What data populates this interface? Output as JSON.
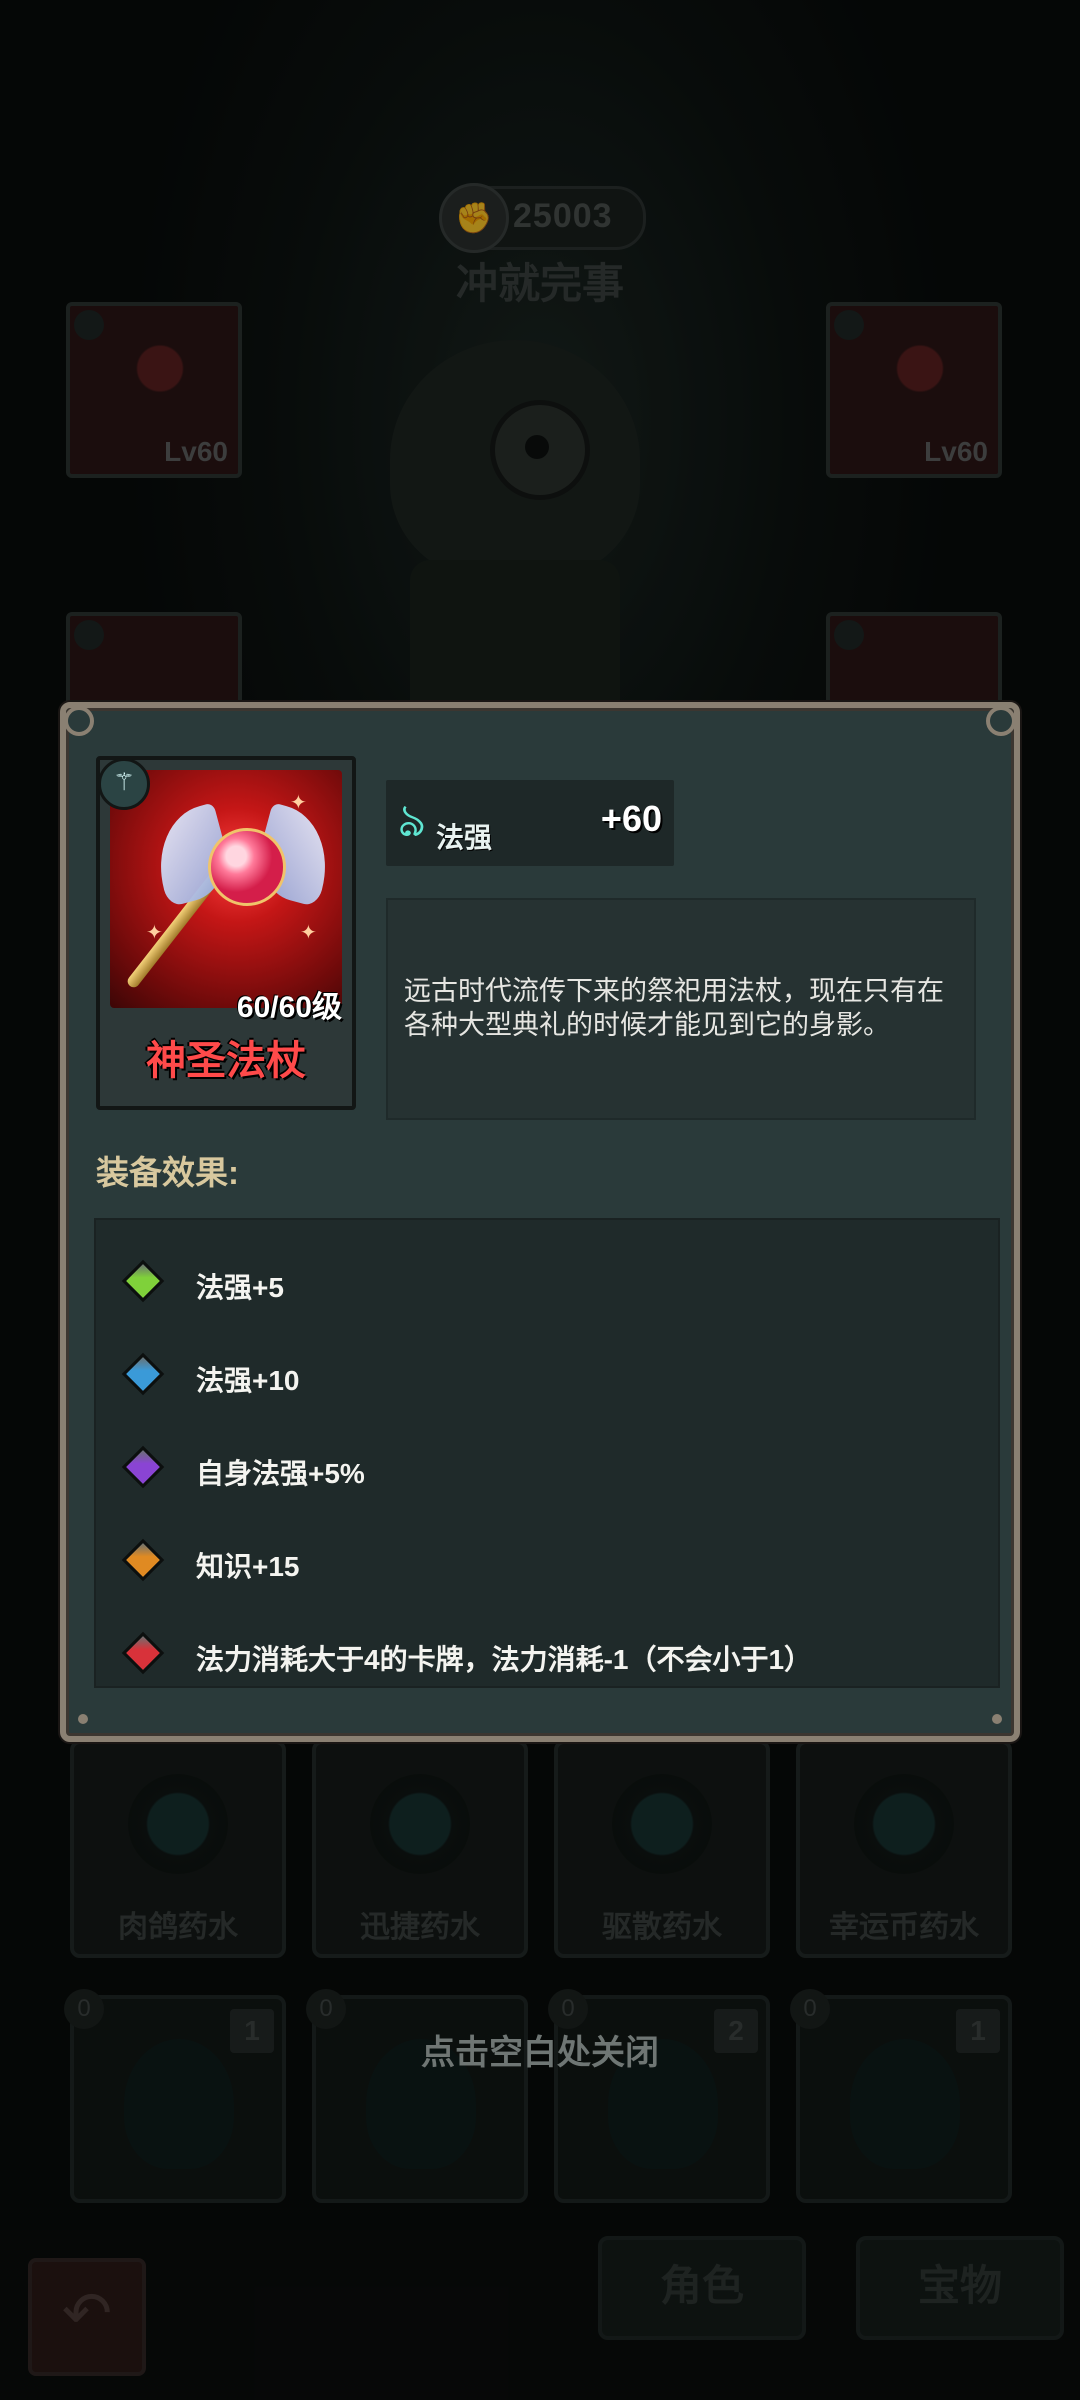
{
  "background": {
    "score": "25003",
    "character_name": "冲就完事",
    "equip_levels": [
      "Lv60",
      "Lv60"
    ],
    "potions": [
      "肉鸽药水",
      "迅捷药水",
      "驱散药水",
      "幸运币药水"
    ],
    "bottle_counts": [
      "1",
      "",
      "2",
      "1"
    ],
    "bottle_zero": "0",
    "tabs": [
      "角色",
      "宝物"
    ]
  },
  "modal": {
    "item": {
      "name": "神圣法杖",
      "level": "60/60级",
      "type_icon": "staff-icon"
    },
    "stat": {
      "label": "法强",
      "value": "+60",
      "icon": "flame-icon"
    },
    "description": "远古时代流传下来的祭祀用法杖，现在只有在各种大型典礼的时候才能见到它的身影。",
    "effects_title": "装备效果:",
    "effects": [
      {
        "text": "法强+5",
        "gem_color": "#7fd13a"
      },
      {
        "text": "法强+10",
        "gem_color": "#3a9ad8"
      },
      {
        "text": "自身法强+5%",
        "gem_color": "#8a44d4"
      },
      {
        "text": "知识+15",
        "gem_color": "#e08a22"
      },
      {
        "text": "法力消耗大于4的卡牌，法力消耗-1（不会小于1）",
        "gem_color": "#d8323a"
      }
    ]
  },
  "close_hint": "点击空白处关闭"
}
